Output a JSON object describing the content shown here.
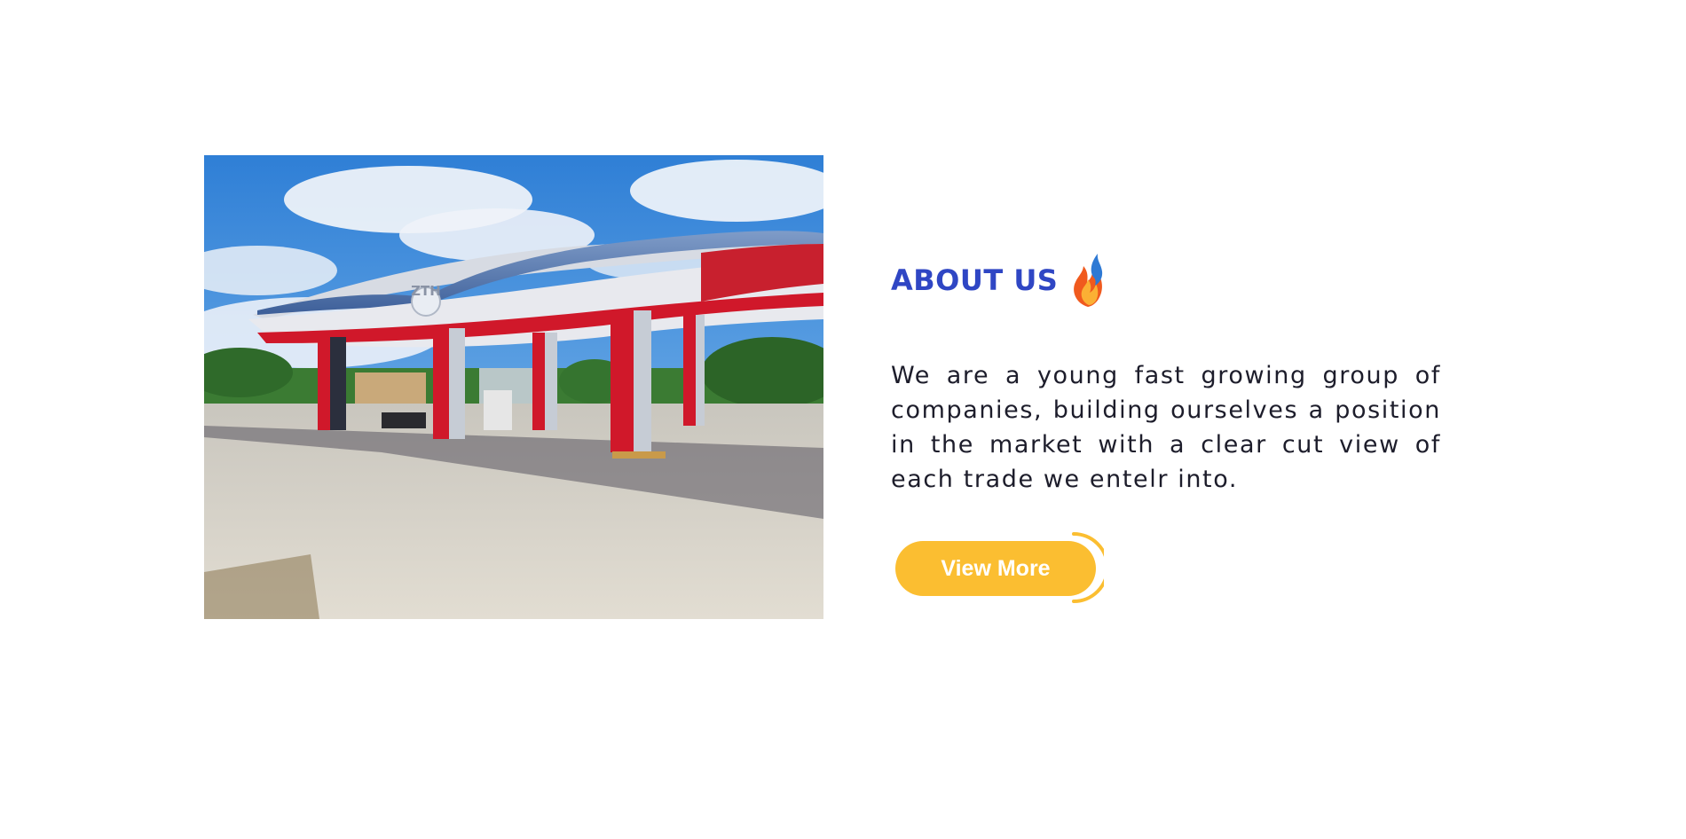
{
  "about": {
    "heading": "ABOUT US",
    "description": "We are a young fast growing group of companies, building ourselves a position in the market with a clear cut view of each trade we entelr into.",
    "button_label": "View More"
  },
  "photo": {
    "sign_text": "ZTH"
  },
  "icons": {
    "flame": "flame-icon"
  },
  "colors": {
    "heading": "#2f46c4",
    "button": "#fbbe31",
    "text": "#1d1d2b"
  }
}
